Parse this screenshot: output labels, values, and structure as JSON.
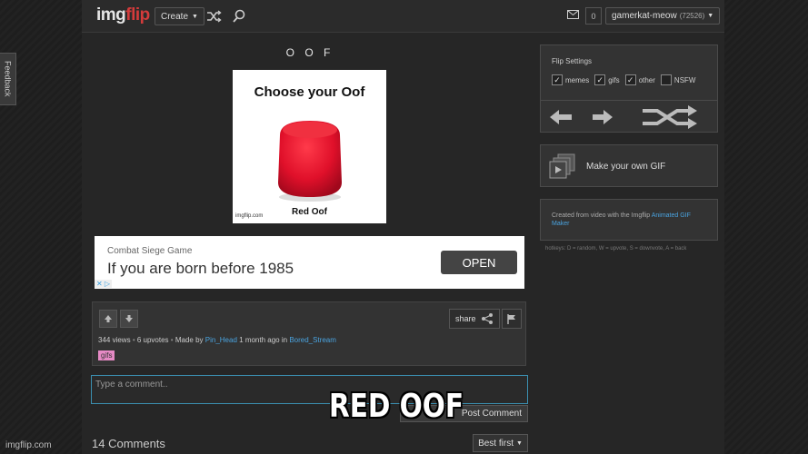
{
  "header": {
    "logo_part1": "img",
    "logo_part2": "flip",
    "create_label": "Create",
    "notifications": "0",
    "username": "gamerkat-meow",
    "points": "(72526)"
  },
  "feedback_label": "Feedback",
  "meme": {
    "title": "O O F",
    "image_heading": "Choose your Oof",
    "image_caption": "Red Oof",
    "image_watermark": "imgflip.com"
  },
  "ad": {
    "advertiser": "Combat Siege Game",
    "headline": "If you are born before 1985",
    "cta": "OPEN",
    "badge": "✕ ▷"
  },
  "info": {
    "share_label": "share",
    "views": "344 views",
    "upvotes": "6 upvotes",
    "made_by_prefix": "Made by",
    "author": "Pin_Head",
    "time": "1 month ago in",
    "stream": "Bored_Stream",
    "tag": "gifs",
    "separator": "•"
  },
  "comment": {
    "placeholder": "Type a comment..",
    "post_label": "Post Comment",
    "count_label": "14 Comments",
    "sort_label": "Best first"
  },
  "flip_settings": {
    "title": "Flip Settings",
    "options": [
      {
        "label": "memes",
        "checked": true
      },
      {
        "label": "gifs",
        "checked": true
      },
      {
        "label": "other",
        "checked": true
      },
      {
        "label": "NSFW",
        "checked": false
      }
    ]
  },
  "make_gif_label": "Make your own GIF",
  "created": {
    "text": "Created from video with the Imgflip ",
    "link": "Animated GIF Maker"
  },
  "hotkeys": "hotkeys: D = random, W = upvote, S = downvote, A = back",
  "watermark": "imgflip.com",
  "overlay_caption": "RED OOF",
  "colors": {
    "logo_accent": "#d33b3b",
    "link": "#4aa3df",
    "tag_bg": "#e68ac5",
    "oof_red": "#e0102a"
  }
}
